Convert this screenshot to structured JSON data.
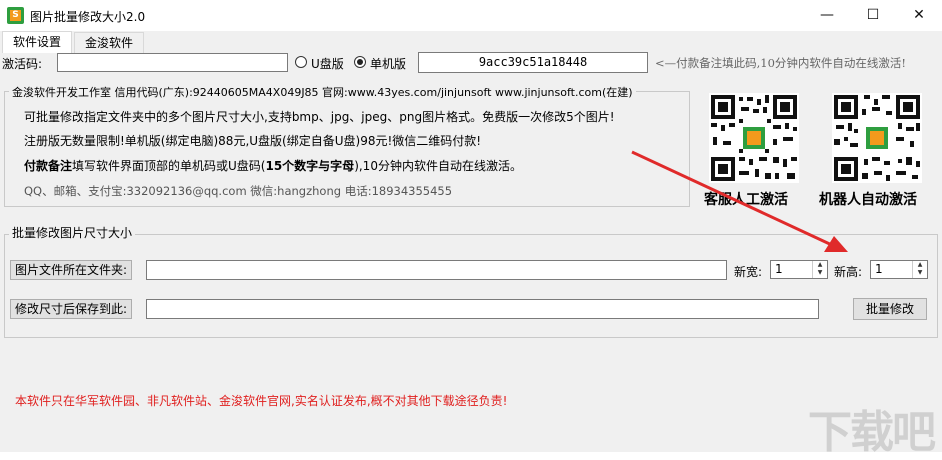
{
  "window": {
    "title": "图片批量修改大小2.0",
    "icon_letter": "S",
    "minimize_glyph": "—",
    "maximize_glyph": "☐",
    "close_glyph": "✕"
  },
  "tabs": [
    {
      "label": "软件设置",
      "active": true
    },
    {
      "label": "金浚软件",
      "active": false
    }
  ],
  "activation": {
    "label": "激活码:",
    "code_value": "",
    "radio_usb_label": "U盘版",
    "radio_pc_label": "单机版",
    "selected": "单机版",
    "machine_code": "9acc39c51a18448",
    "hint": "<—付款备注填此码,10分钟内软件自动在线激活!"
  },
  "info": {
    "legend": "金浚软件开发工作室 信用代码(广东):92440605MA4X049J85 官网:www.43yes.com/jinjunsoft  www.jinjunsoft.com(在建)",
    "line1": "可批量修改指定文件夹中的多个图片尺寸大小,支持bmp、jpg、jpeg、png图片格式。免费版一次修改5个图片!",
    "line2": "注册版无数量限制!单机版(绑定电脑)88元,U盘版(绑定自备U盘)98元!微信二维码付款!",
    "line3_bold": "付款备注",
    "line3_rest": "填写软件界面顶部的单机码或U盘码(",
    "line3_bold2": "15个数字与字母",
    "line3_end": "),10分钟内软件自动在线激活。",
    "contact": "QQ、邮箱、支付宝:332092136@qq.com    微信:hangzhong    电话:18934355455"
  },
  "qr": [
    {
      "caption": "客服人工激活",
      "icon": "qr-code-icon"
    },
    {
      "caption": "机器人自动激活",
      "icon": "qr-code-icon"
    }
  ],
  "resize": {
    "legend": "批量修改图片尺寸大小",
    "source_button": "图片文件所在文件夹:",
    "source_value": "",
    "width_label": "新宽:",
    "width_value": "1",
    "height_label": "新高:",
    "height_value": "1",
    "target_button": "修改尺寸后保存到此:",
    "target_value": "",
    "run_button": "批量修改"
  },
  "footer": {
    "notice": "本软件只在华军软件园、非凡软件站、金浚软件官网,实名认证发布,概不对其他下载途径负责!",
    "notice_color": "#e0201f",
    "watermark": "下载吧"
  },
  "colors": {
    "arrow": "#e02a2a",
    "brand_green": "#2e9e3f",
    "brand_orange": "#f39a1c"
  }
}
